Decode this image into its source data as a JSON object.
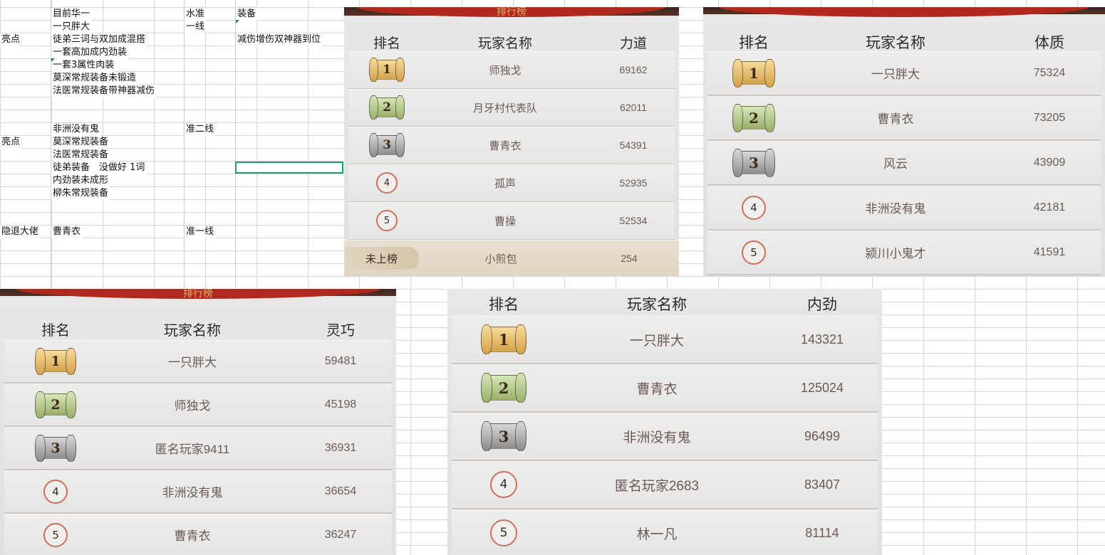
{
  "spreadsheet": {
    "cells": [
      {
        "col": 1,
        "row": 0,
        "text": "目前华一"
      },
      {
        "col": 2,
        "row": 0,
        "text": "水准"
      },
      {
        "col": 3,
        "row": 0,
        "text": "装备"
      },
      {
        "col": 1,
        "row": 1,
        "text": "一只胖大"
      },
      {
        "col": 2,
        "row": 1,
        "text": "一线"
      },
      {
        "col": 0,
        "row": 2,
        "text": "亮点"
      },
      {
        "col": 1,
        "row": 2,
        "text": "徒弟三词与双加成混搭"
      },
      {
        "col": 3,
        "row": 2,
        "text": "减伤增伤双神器到位"
      },
      {
        "col": 1,
        "row": 3,
        "text": "一套高加成内劲装"
      },
      {
        "col": 1,
        "row": 4,
        "text": "一套3属性肉装"
      },
      {
        "col": 1,
        "row": 5,
        "text": "莫深常规装备未锻造"
      },
      {
        "col": 1,
        "row": 6,
        "text": "法医常规装备带神器减伤"
      },
      {
        "col": 1,
        "row": 9,
        "text": "非洲没有鬼"
      },
      {
        "col": 2,
        "row": 9,
        "text": "准二线"
      },
      {
        "col": 0,
        "row": 10,
        "text": "亮点"
      },
      {
        "col": 1,
        "row": 10,
        "text": "莫深常规装备"
      },
      {
        "col": 1,
        "row": 11,
        "text": "法医常规装备"
      },
      {
        "col": 1,
        "row": 12,
        "text": "徒弟装备　没做好 1词"
      },
      {
        "col": 1,
        "row": 13,
        "text": "内劲装未成形"
      },
      {
        "col": 1,
        "row": 14,
        "text": "柳朱常规装备"
      },
      {
        "col": 0,
        "row": 17,
        "text": "隐退大佬"
      },
      {
        "col": 1,
        "row": 17,
        "text": "曹青衣"
      },
      {
        "col": 2,
        "row": 17,
        "text": "准一线"
      }
    ]
  },
  "panels": [
    {
      "id": "strength",
      "banner": "排行榜",
      "headers": {
        "rank": "排名",
        "name": "玩家名称",
        "stat": "力道"
      },
      "rows": [
        {
          "rank": "1",
          "name": "师独戈",
          "value": "69162"
        },
        {
          "rank": "2",
          "name": "月牙村代表队",
          "value": "62011"
        },
        {
          "rank": "3",
          "name": "曹青衣",
          "value": "54391"
        },
        {
          "rank": "4",
          "name": "孤声",
          "value": "52935"
        },
        {
          "rank": "5",
          "name": "曹操",
          "value": "52534"
        }
      ],
      "self": {
        "rank": "未上榜",
        "name": "小煎包",
        "value": "254"
      }
    },
    {
      "id": "constitution",
      "headers": {
        "rank": "排名",
        "name": "玩家名称",
        "stat": "体质"
      },
      "rows": [
        {
          "rank": "1",
          "name": "一只胖大",
          "value": "75324"
        },
        {
          "rank": "2",
          "name": "曹青衣",
          "value": "73205"
        },
        {
          "rank": "3",
          "name": "风云",
          "value": "43909"
        },
        {
          "rank": "4",
          "name": "非洲没有鬼",
          "value": "42181"
        },
        {
          "rank": "5",
          "name": "颍川小鬼才",
          "value": "41591"
        }
      ]
    },
    {
      "id": "agility",
      "banner": "排行榜",
      "headers": {
        "rank": "排名",
        "name": "玩家名称",
        "stat": "灵巧"
      },
      "rows": [
        {
          "rank": "1",
          "name": "一只胖大",
          "value": "59481"
        },
        {
          "rank": "2",
          "name": "师独戈",
          "value": "45198"
        },
        {
          "rank": "3",
          "name": "匿名玩家9411",
          "value": "36931"
        },
        {
          "rank": "4",
          "name": "非洲没有鬼",
          "value": "36654"
        },
        {
          "rank": "5",
          "name": "曹青衣",
          "value": "36247"
        }
      ]
    },
    {
      "id": "inner-force",
      "headers": {
        "rank": "排名",
        "name": "玩家名称",
        "stat": "内劲"
      },
      "rows": [
        {
          "rank": "1",
          "name": "一只胖大",
          "value": "143321"
        },
        {
          "rank": "2",
          "name": "曹青衣",
          "value": "125024"
        },
        {
          "rank": "3",
          "name": "非洲没有鬼",
          "value": "96499"
        },
        {
          "rank": "4",
          "name": "匿名玩家2683",
          "value": "83407"
        },
        {
          "rank": "5",
          "name": "林一凡",
          "value": "81114"
        }
      ]
    }
  ],
  "colors": {
    "gold": "#d4a24c",
    "green": "#99b06a",
    "silver": "#8c8c8c",
    "circle": "#c9705d",
    "selection": "#1f9d6b",
    "banner_red": "#b0281e"
  },
  "icons": [
    "rank-1-scroll-icon",
    "rank-2-scroll-icon",
    "rank-3-scroll-icon",
    "rank-circle-icon"
  ]
}
